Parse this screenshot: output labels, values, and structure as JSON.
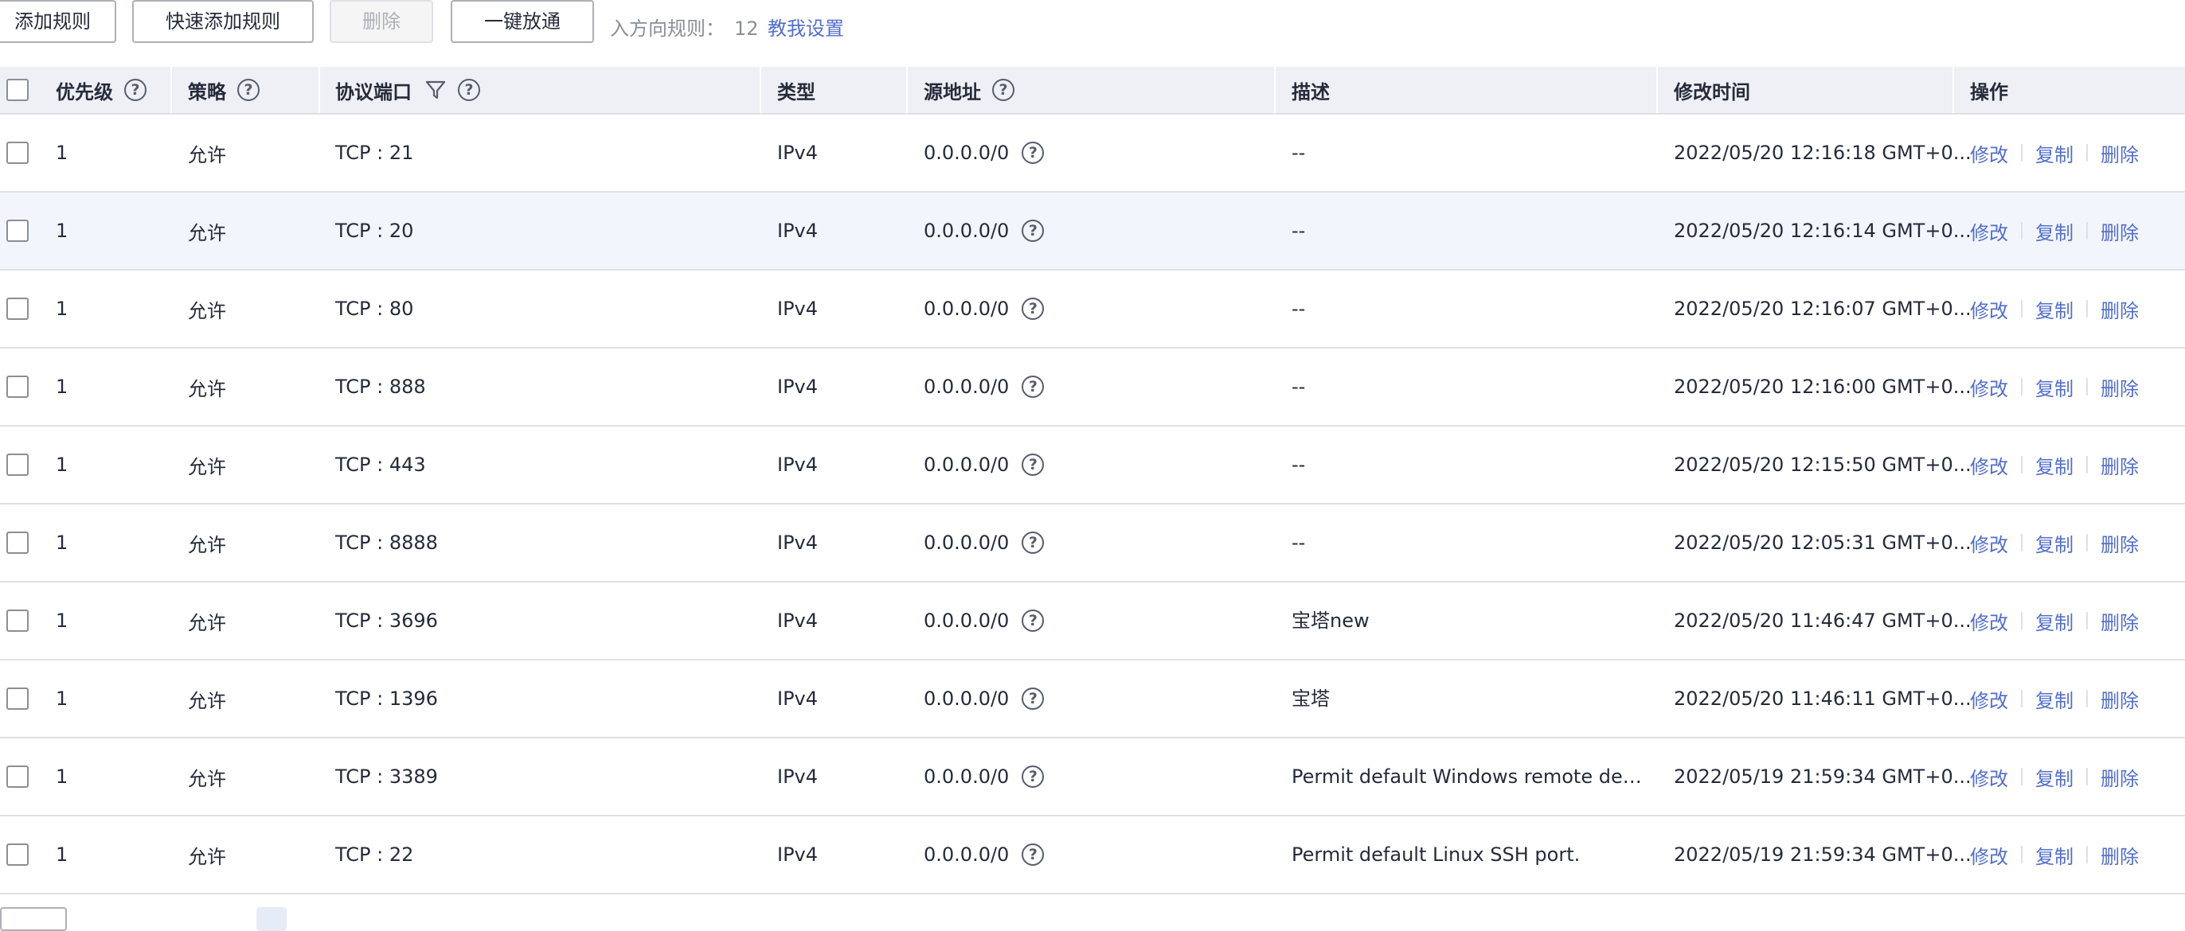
{
  "toolbar": {
    "add_rule": "添加规则",
    "quick_add_rule": "快速添加规则",
    "delete": "删除",
    "one_click_open": "一键放通",
    "inbound_label": "入方向规则：",
    "inbound_count": "12",
    "guide_link": "教我设置"
  },
  "columns": {
    "priority": "优先级",
    "policy": "策略",
    "protocol_port": "协议端口",
    "type": "类型",
    "source": "源地址",
    "description": "描述",
    "modified": "修改时间",
    "actions": "操作"
  },
  "icons": {
    "help": "help-circle-icon",
    "filter": "filter-icon",
    "help_glyph": "?"
  },
  "actions": {
    "edit": "修改",
    "copy": "复制",
    "delete": "删除"
  },
  "rows": [
    {
      "priority": "1",
      "policy": "允许",
      "port": "TCP : 21",
      "type": "IPv4",
      "source": "0.0.0.0/0",
      "description": "--",
      "modified": "2022/05/20 12:16:18 GMT+0..."
    },
    {
      "priority": "1",
      "policy": "允许",
      "port": "TCP : 20",
      "type": "IPv4",
      "source": "0.0.0.0/0",
      "description": "--",
      "modified": "2022/05/20 12:16:14 GMT+0..."
    },
    {
      "priority": "1",
      "policy": "允许",
      "port": "TCP : 80",
      "type": "IPv4",
      "source": "0.0.0.0/0",
      "description": "--",
      "modified": "2022/05/20 12:16:07 GMT+0..."
    },
    {
      "priority": "1",
      "policy": "允许",
      "port": "TCP : 888",
      "type": "IPv4",
      "source": "0.0.0.0/0",
      "description": "--",
      "modified": "2022/05/20 12:16:00 GMT+0..."
    },
    {
      "priority": "1",
      "policy": "允许",
      "port": "TCP : 443",
      "type": "IPv4",
      "source": "0.0.0.0/0",
      "description": "--",
      "modified": "2022/05/20 12:15:50 GMT+0..."
    },
    {
      "priority": "1",
      "policy": "允许",
      "port": "TCP : 8888",
      "type": "IPv4",
      "source": "0.0.0.0/0",
      "description": "--",
      "modified": "2022/05/20 12:05:31 GMT+0..."
    },
    {
      "priority": "1",
      "policy": "允许",
      "port": "TCP : 3696",
      "type": "IPv4",
      "source": "0.0.0.0/0",
      "description": "宝塔new",
      "modified": "2022/05/20 11:46:47 GMT+0..."
    },
    {
      "priority": "1",
      "policy": "允许",
      "port": "TCP : 1396",
      "type": "IPv4",
      "source": "0.0.0.0/0",
      "description": "宝塔",
      "modified": "2022/05/20 11:46:11 GMT+0..."
    },
    {
      "priority": "1",
      "policy": "允许",
      "port": "TCP : 3389",
      "type": "IPv4",
      "source": "0.0.0.0/0",
      "description": "Permit default Windows remote deskt...",
      "modified": "2022/05/19 21:59:34 GMT+0..."
    },
    {
      "priority": "1",
      "policy": "允许",
      "port": "TCP : 22",
      "type": "IPv4",
      "source": "0.0.0.0/0",
      "description": "Permit default Linux SSH port.",
      "modified": "2022/05/19 21:59:34 GMT+0..."
    }
  ],
  "colors": {
    "link": "#526ecc",
    "header_bg": "#eef0f5",
    "highlight_row": "#f2f5fc",
    "border": "#dfe1e6"
  }
}
